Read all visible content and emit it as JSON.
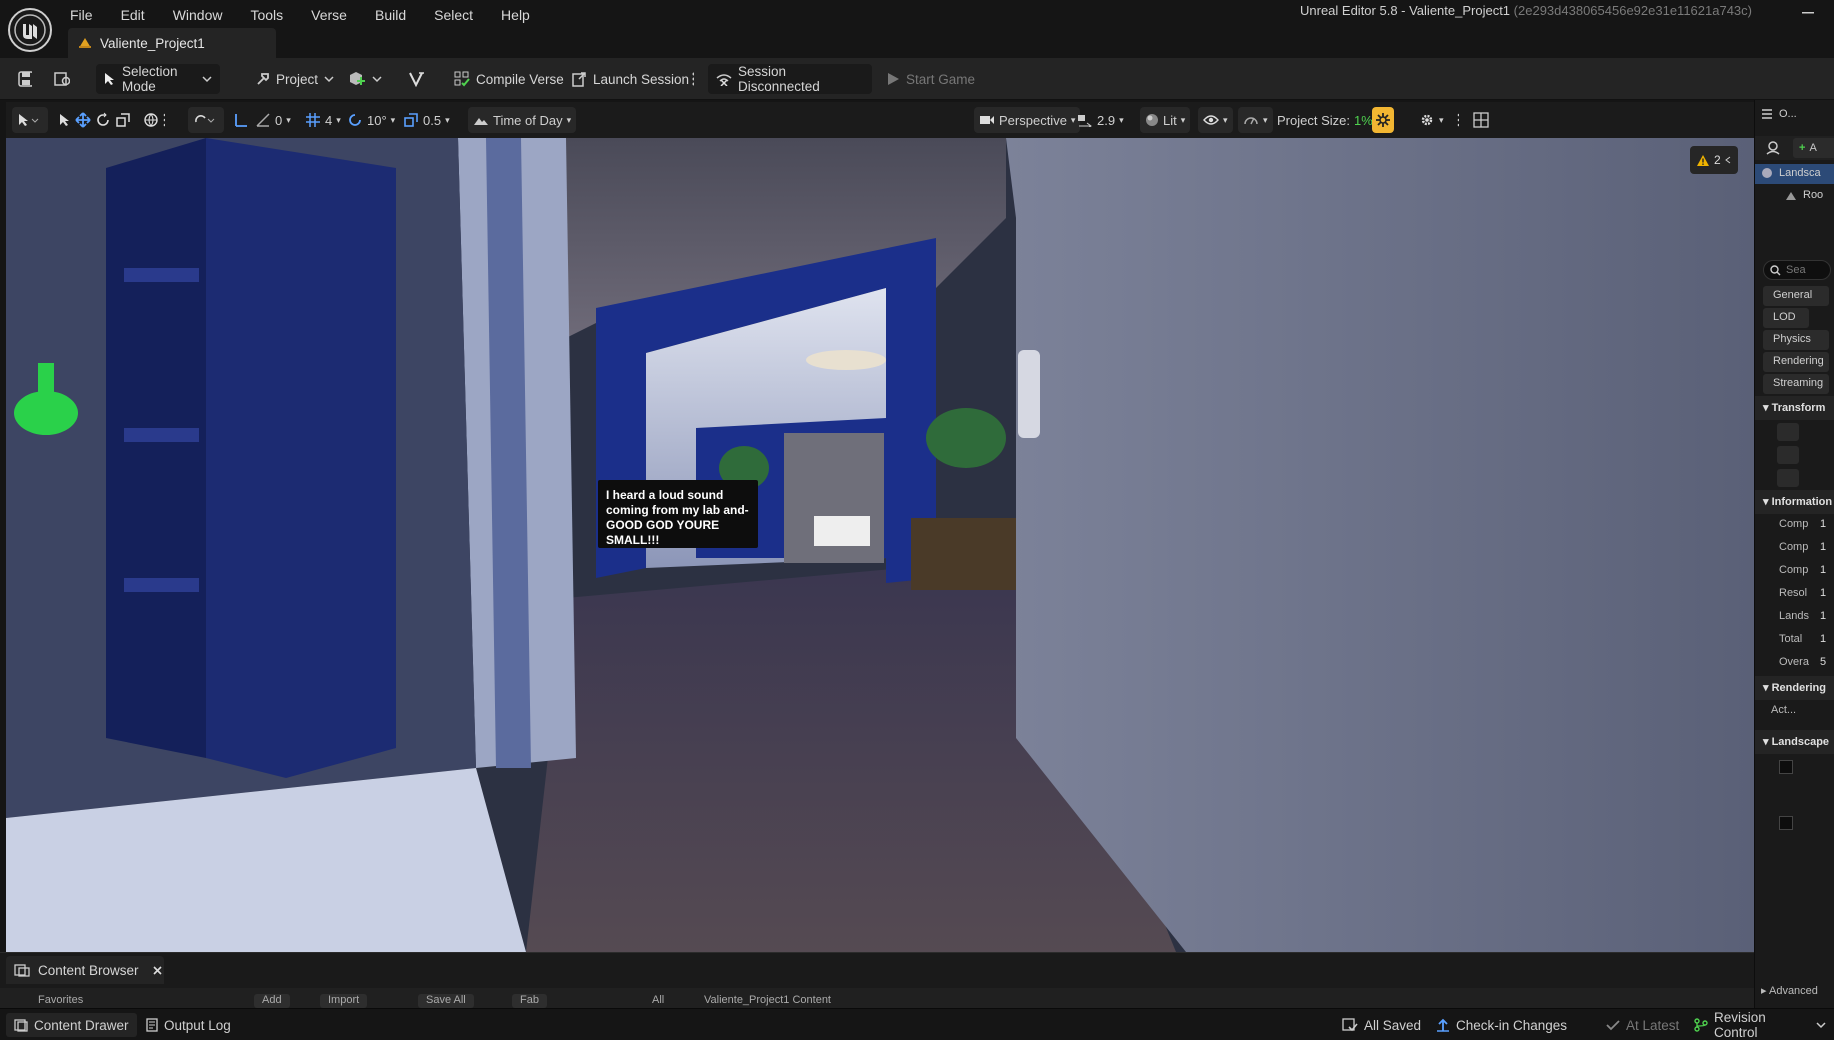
{
  "menu": [
    "File",
    "Edit",
    "Window",
    "Tools",
    "Verse",
    "Build",
    "Select",
    "Help"
  ],
  "project_tab": "Valiente_Project1",
  "app_title": "Unreal Editor 5.8 - Valiente_Project1",
  "app_hash": "(2e293d438065456e92e31e11621a743c)",
  "toolbar": {
    "selection_mode": "Selection Mode",
    "project": "Project",
    "compile_verse": "Compile Verse",
    "launch_session": "Launch Session",
    "session_status": "Session Disconnected",
    "start_game": "Start Game"
  },
  "viewport_toolbar": {
    "snap_rotation_count": "0",
    "grid_size": "4",
    "rotation_snap": "10°",
    "scale_snap": "0.5",
    "time_of_day": "Time of Day",
    "perspective": "Perspective",
    "camera_speed": "2.9",
    "lit": "Lit",
    "project_size_label": "Project Size:",
    "project_size_value": "1%"
  },
  "viewport": {
    "speech_bubble": [
      "I heard a loud sound",
      "coming from my lab and-",
      "GOOD GOD YOURE SMALL!!!"
    ],
    "warning_count": "2"
  },
  "right_panel": {
    "outliner_title": "O...",
    "add_button": "A",
    "tree": [
      "Landsca",
      "Roo"
    ],
    "search_placeholder": "Sea",
    "filters": [
      "General",
      "LOD",
      "Physics",
      "Rendering",
      "Streaming"
    ],
    "sections": [
      "Transform",
      "Information",
      "Rendering",
      "Landscape"
    ],
    "info_rows": [
      {
        "key": "Comp",
        "value": "1"
      },
      {
        "key": "Comp",
        "value": "1"
      },
      {
        "key": "Comp",
        "value": "1"
      },
      {
        "key": "Resol",
        "value": "1"
      },
      {
        "key": "Lands",
        "value": "1"
      },
      {
        "key": "Total",
        "value": "1"
      },
      {
        "key": "Overa",
        "value": "5"
      }
    ],
    "rendering_row": "Act...",
    "advanced": "Advanced"
  },
  "content_browser": {
    "tab": "Content Browser",
    "ghost": [
      "Favorites",
      "Add",
      "Import",
      "Save All",
      "Fab",
      "All",
      "Valiente_Project1 Content"
    ]
  },
  "status_bar": {
    "content_drawer": "Content Drawer",
    "output_log": "Output Log",
    "all_saved": "All Saved",
    "check_in": "Check-in Changes",
    "at_latest": "At Latest",
    "revision_control": "Revision Control"
  },
  "colors": {
    "accent_green": "#4fd14f",
    "warning": "#f0b400",
    "wall_blue": "#1b2f8a",
    "highlight": "#f2b632"
  }
}
